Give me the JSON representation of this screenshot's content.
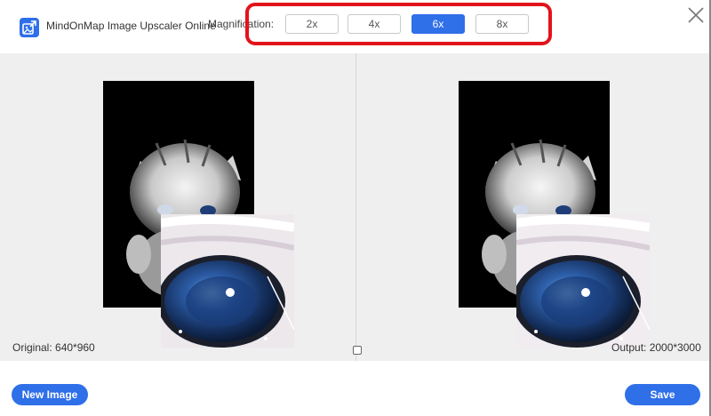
{
  "app": {
    "title": "MindOnMap Image Upscaler Online",
    "accent_color": "#2f6fe8",
    "logo_icon": "upscale-image-icon"
  },
  "magnification": {
    "label": "Magnification:",
    "options": [
      "2x",
      "4x",
      "6x",
      "8x"
    ],
    "selected": "6x",
    "highlight_color": "#e2131a"
  },
  "preview": {
    "original_caption": "Original: 640*960",
    "output_caption": "Output: 2000*3000",
    "image_subject": "white kitten on black background with magnified eye",
    "compare_icon": "compare-icon"
  },
  "actions": {
    "new_image_label": "New Image",
    "save_label": "Save"
  },
  "window": {
    "close_icon": "close-icon"
  }
}
